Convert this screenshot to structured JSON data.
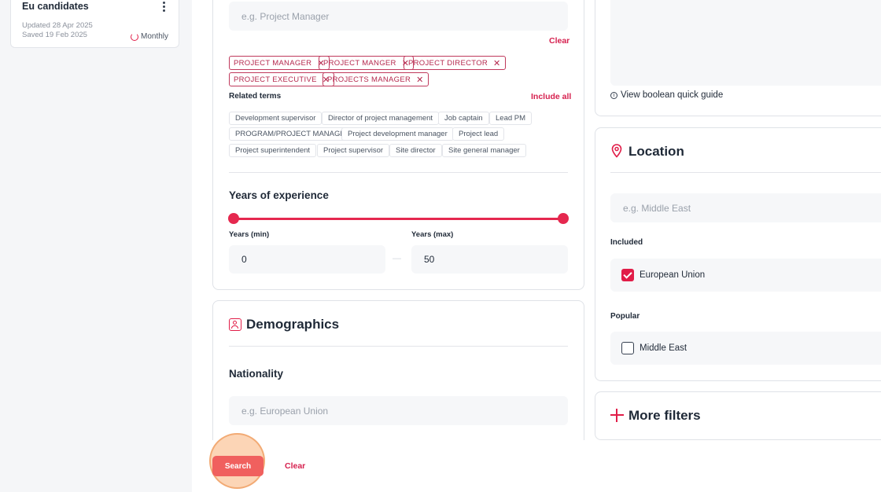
{
  "sidebar": {
    "saved_search": {
      "title": "Eu candidates",
      "updated_label": "Updated",
      "updated_date": "28 Apr 2025",
      "saved_label": "Saved",
      "saved_date": "19 Feb 2025",
      "frequency": "Monthly"
    }
  },
  "job_title": {
    "placeholder": "e.g. Project Manager",
    "clear_label": "Clear",
    "chips": [
      "PROJECT MANAGER",
      "PROJECT MANGER",
      "PROJECT DIRECTOR",
      "PROJECT EXECUTIVE",
      "PROJECTS MANAGER"
    ],
    "related_terms_label": "Related terms",
    "include_all_label": "Include all",
    "related_terms": [
      "Development supervisor",
      "Director of project management",
      "Job captain",
      "Lead PM",
      "PROGRAM/PROJECT MANAGER",
      "Project development manager",
      "Project lead",
      "Project superintendent",
      "Project supervisor",
      "Site director",
      "Site general manager"
    ]
  },
  "experience": {
    "title": "Years of experience",
    "min_label": "Years (min)",
    "max_label": "Years (max)",
    "min_value": "0",
    "max_value": "50",
    "separator": "—"
  },
  "demographics": {
    "title": "Demographics",
    "nationality_label": "Nationality",
    "nationality_placeholder": "e.g. European Union"
  },
  "boolean": {
    "guide_label": "View boolean quick guide"
  },
  "location": {
    "title": "Location",
    "placeholder": "e.g. Middle East",
    "included_label": "Included",
    "included_items": [
      {
        "label": "European Union",
        "checked": true
      }
    ],
    "popular_label": "Popular",
    "popular_items": [
      {
        "label": "Middle East",
        "checked": false
      }
    ]
  },
  "more_filters": {
    "label": "More filters"
  },
  "actions": {
    "search_label": "Search",
    "clear_label": "Clear"
  },
  "colors": {
    "accent": "#e11d48",
    "search_button": "#f0605e"
  }
}
